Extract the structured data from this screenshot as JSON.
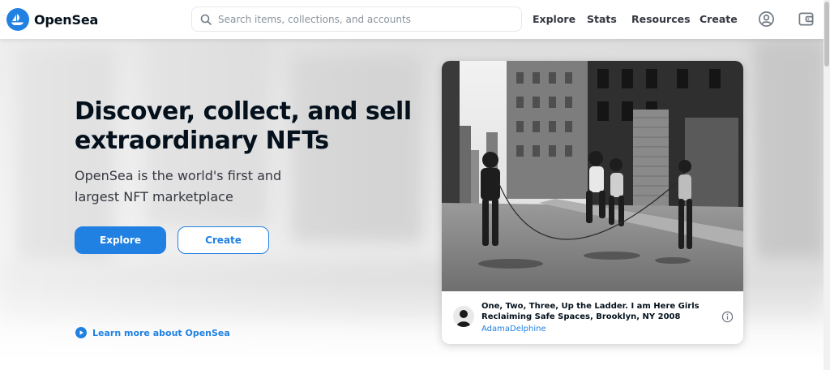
{
  "header": {
    "logo_text": "OpenSea",
    "search_placeholder": "Search items, collections, and accounts",
    "nav": [
      "Explore",
      "Stats",
      "Resources",
      "Create"
    ],
    "icons": [
      "account-icon",
      "wallet-icon"
    ]
  },
  "hero": {
    "headline": "Discover, collect, and sell extraordinary NFTs",
    "subhead": "OpenSea is the world's first and largest NFT marketplace",
    "buttons": {
      "explore": "Explore",
      "create": "Create"
    },
    "learn_more": "Learn more about OpenSea"
  },
  "featured": {
    "title": "One, Two, Three, Up the Ladder. I am Here Girls Reclaiming Safe Spaces, Brooklyn, NY 2008",
    "creator": "AdamaDelphine"
  },
  "colors": {
    "brand": "#2081e2",
    "text_primary": "#04111d",
    "text_secondary": "#353840",
    "placeholder": "#8a939b"
  }
}
